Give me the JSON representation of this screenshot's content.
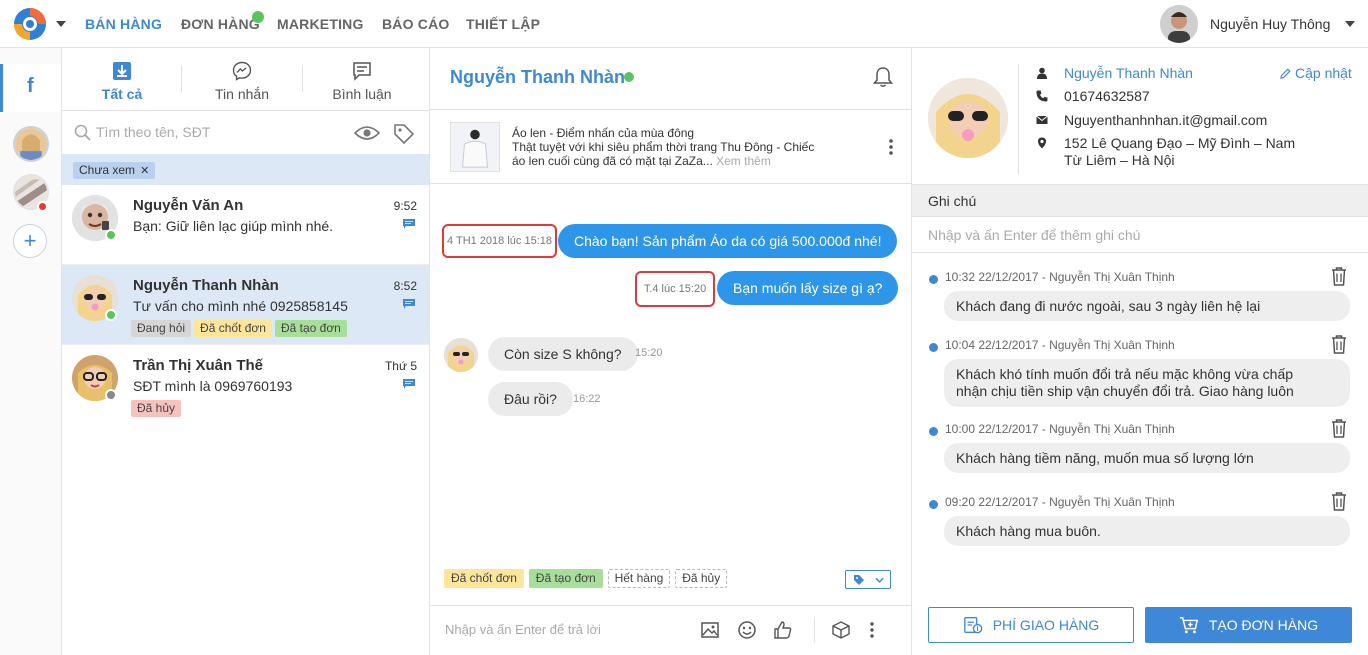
{
  "nav": {
    "items": [
      "BÁN HÀNG",
      "ĐƠN HÀNG",
      "MARKETING",
      "BÁO CÁO",
      "THIẾT LẬP"
    ],
    "active_index": 0,
    "user_name": "Nguyễn Huy Thông"
  },
  "rail": {
    "facebook_glyph": "f",
    "add_glyph": "+"
  },
  "list": {
    "tabs": [
      "Tất cả",
      "Tin nhắn",
      "Bình luận"
    ],
    "search_placeholder": "Tìm theo tên, SĐT",
    "filter_chip": "Chưa xem",
    "conversations": [
      {
        "name": "Nguyễn Văn An",
        "message": "Bạn: Giữ liên lạc giúp mình nhé.",
        "time": "9:52",
        "status_color": "#5bc45f",
        "tags": []
      },
      {
        "name": "Nguyễn Thanh Nhàn",
        "message": "Tư vấn cho mình nhé 0925858145",
        "time": "8:52",
        "status_color": "#5bc45f",
        "tags": [
          {
            "label": "Đang hỏi",
            "style": "gray"
          },
          {
            "label": "Đã chốt đơn",
            "style": "yellow"
          },
          {
            "label": "Đã tạo đơn",
            "style": "green"
          }
        ]
      },
      {
        "name": "Trần Thị Xuân Thế",
        "message": "SĐT mình là 0969760193",
        "time": "Thứ 5",
        "status_color": "#8a8a8a",
        "tags": [
          {
            "label": "Đã hủy",
            "style": "red"
          }
        ]
      }
    ]
  },
  "chat": {
    "contact_name": "Nguyễn Thanh Nhàn",
    "post": {
      "line1": "Áo len - Điểm nhấn của mùa đông",
      "line2": "Thật tuyệt với khi siêu phẩm thời trang Thu Đông - Chiếc",
      "line3": "áo len cuối cùng đã có mặt tại ZaZa...",
      "more": "Xem thêm"
    },
    "messages": [
      {
        "dir": "out",
        "text": "Chào bạn! Sản phẩm Áo da có giá 500.000đ nhé!",
        "time": "4 TH1 2018 lúc 15:18"
      },
      {
        "dir": "out",
        "text": "Bạn muốn lấy size gì ạ?",
        "time": "T.4 lúc 15:20"
      },
      {
        "dir": "in",
        "text": "Còn size S không?",
        "time": "15:20"
      },
      {
        "dir": "in",
        "text": "Đâu rồi?",
        "time": "16:22"
      }
    ],
    "quick_tags": [
      {
        "label": "Đã chốt đơn",
        "style": "yellow"
      },
      {
        "label": "Đã tạo đơn",
        "style": "green"
      },
      {
        "label": "Hết hàng",
        "style": "dash"
      },
      {
        "label": "Đã hủy",
        "style": "dash"
      }
    ],
    "composer_placeholder": "Nhập và ấn Enter để trả lời"
  },
  "customer": {
    "name": "Nguyễn Thanh Nhàn",
    "phone": "01674632587",
    "email": "Nguyenthanhnhan.it@gmail.com",
    "address_line1": "152 Lê Quang Đạo – Mỹ Đình – Nam",
    "address_line2": "Từ Liêm – Hà Nội",
    "edit_label": "Cập nhật",
    "notes_title": "Ghi chú",
    "notes_placeholder": "Nhập và ấn Enter để thêm ghi chú",
    "notes": [
      {
        "meta": "10:32 22/12/2017 - Nguyễn Thị Xuân Thịnh",
        "line1": "Khách đang đi nước ngoài, sau 3 ngày liên hệ lại",
        "line2": ""
      },
      {
        "meta": "10:04 22/12/2017 - Nguyễn Thị Xuân Thịnh",
        "line1": "Khách khó tính muốn đổi trả nếu mặc không vừa chấp",
        "line2": "nhận chịu tiền ship vận chuyển đổi trả. Giao hàng luôn"
      },
      {
        "meta": "10:00 22/12/2017 - Nguyễn Thị Xuân Thịnh",
        "line1": "Khách hàng tiềm năng, muốn mua số lượng lớn",
        "line2": ""
      },
      {
        "meta": "09:20 22/12/2017 - Nguyễn Thị Xuân Thịnh",
        "line1": "Khách hàng mua buôn.",
        "line2": ""
      }
    ],
    "shipping_button": "PHÍ GIAO HÀNG",
    "order_button": "TẠO ĐƠN HÀNG"
  },
  "colors": {
    "accent": "#3f88d7",
    "bubble_out": "#2e96e9",
    "online": "#5bc45f",
    "highlight_box": "#e0393b"
  }
}
